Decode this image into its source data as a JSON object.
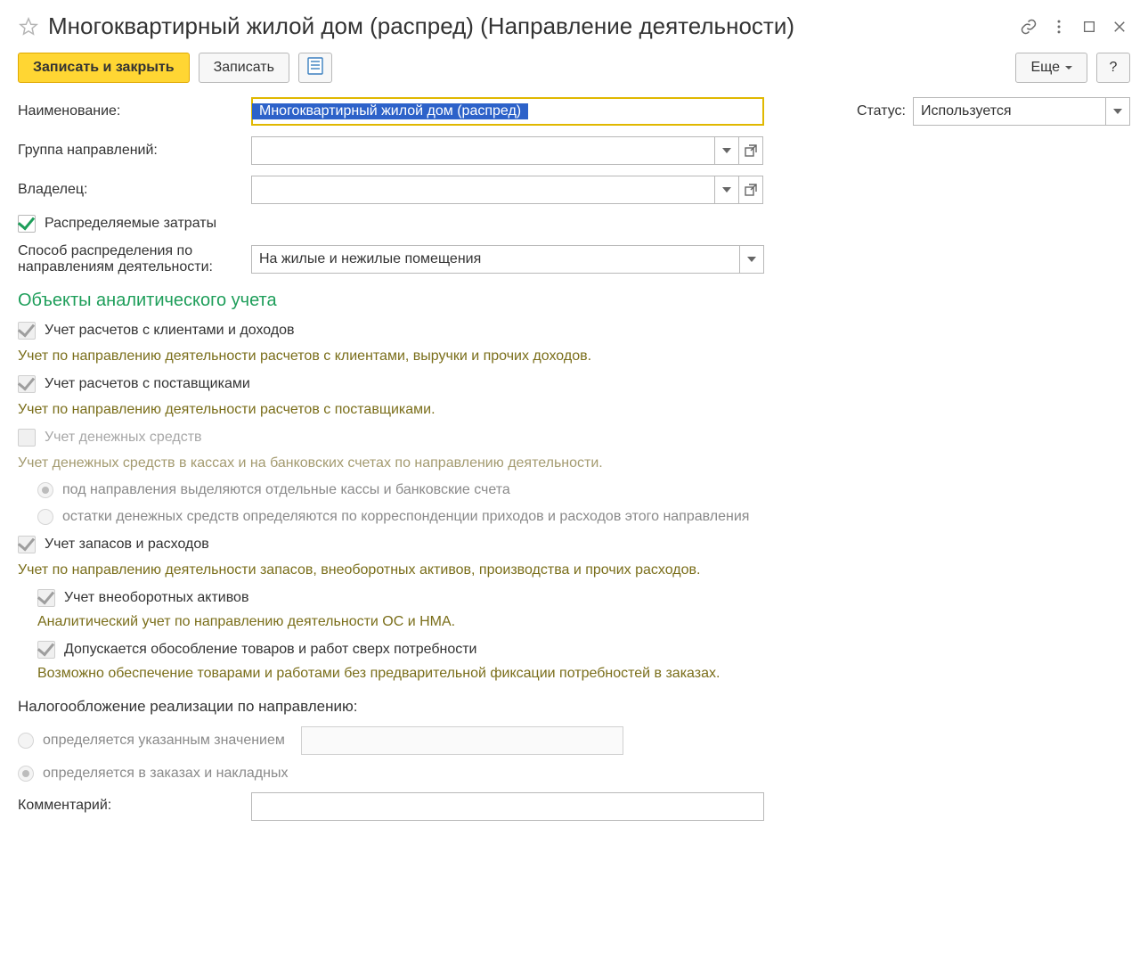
{
  "header": {
    "title": "Многоквартирный жилой дом (распред) (Направление деятельности)"
  },
  "toolbar": {
    "save_close": "Записать и закрыть",
    "save": "Записать",
    "more": "Еще",
    "help": "?"
  },
  "labels": {
    "name": "Наименование:",
    "status": "Статус:",
    "group": "Группа направлений:",
    "owner": "Владелец:",
    "dist_method": "Способ распределения по направлениям деятельности:",
    "comment": "Комментарий:"
  },
  "fields": {
    "name_value": "Многоквартирный жилой дом (распред)",
    "status_value": "Используется",
    "group_value": "",
    "owner_value": "",
    "dist_method_value": "На жилые и нежилые помещения",
    "tax_value_input": "",
    "comment_value": ""
  },
  "checks": {
    "distributed": "Распределяемые затраты",
    "clients": "Учет расчетов с клиентами и доходов",
    "clients_note": "Учет по направлению деятельности расчетов с клиентами, выручки и прочих доходов.",
    "suppliers": "Учет расчетов с поставщиками",
    "suppliers_note": "Учет по направлению деятельности расчетов с поставщиками.",
    "cash": "Учет денежных средств",
    "cash_note": "Учет денежных средств в кассах и на банковских счетах по направлению деятельности.",
    "cash_radio1": "под направления выделяются отдельные кассы и банковские счета",
    "cash_radio2": "остатки денежных средств определяются по корреспонденции приходов и расходов этого направления",
    "stock": "Учет запасов и расходов",
    "stock_note": "Учет по направлению деятельности запасов, внеоборотных активов, производства и прочих расходов.",
    "fixed_assets": "Учет внеоборотных активов",
    "fixed_assets_note": "Аналитический учет по направлению деятельности ОС и НМА.",
    "allow_over": "Допускается обособление товаров и работ сверх потребности",
    "allow_over_note": "Возможно обеспечение товарами и работами без предварительной фиксации потребностей в заказах."
  },
  "section": {
    "analytics": "Объекты аналитического учета"
  },
  "tax": {
    "header": "Налогообложение реализации по направлению:",
    "by_value": "определяется указанным значением",
    "by_orders": "определяется в заказах и накладных"
  }
}
